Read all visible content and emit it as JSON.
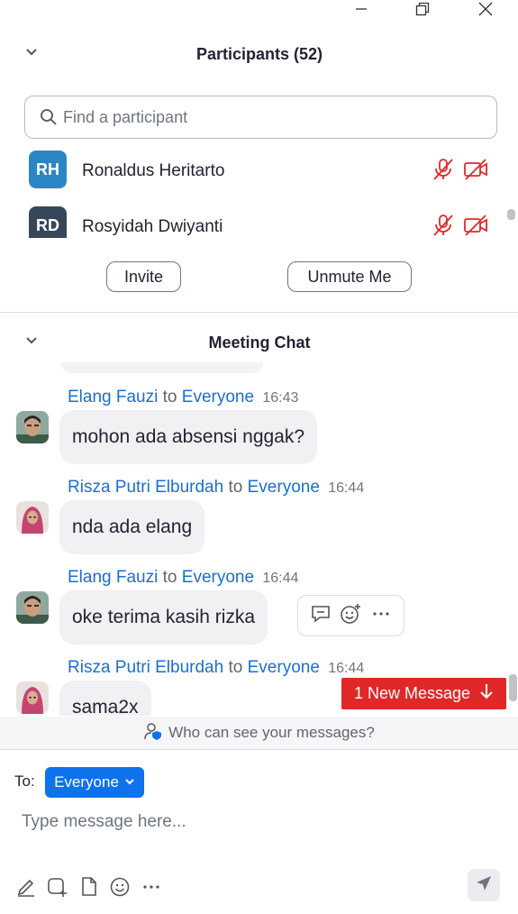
{
  "participants_panel": {
    "title": "Participants (52)",
    "search_placeholder": "Find a participant",
    "participants": [
      {
        "initials": "RH",
        "name": "Ronaldus Heritarto",
        "avatar_color": "#2d86c4",
        "mic_muted": true,
        "video_off": true
      },
      {
        "initials": "RD",
        "name": "Rosyidah Dwiyanti",
        "avatar_color": "#37475b",
        "mic_muted": true,
        "video_off": true
      }
    ],
    "invite_label": "Invite",
    "unmute_label": "Unmute Me"
  },
  "chat_panel": {
    "title": "Meeting Chat",
    "messages": [
      {
        "sender": "Elang Fauzi",
        "to_word": "to",
        "recipient": "Everyone",
        "time": "16:43",
        "text": "mohon ada absensi nggak?",
        "avatar": "male-photo"
      },
      {
        "sender": "Risza Putri Elburdah",
        "to_word": "to",
        "recipient": "Everyone",
        "time": "16:44",
        "text": "nda ada elang",
        "avatar": "female-hijab-photo"
      },
      {
        "sender": "Elang Fauzi",
        "to_word": "to",
        "recipient": "Everyone",
        "time": "16:44",
        "text": "oke terima kasih rizka",
        "avatar": "male-photo"
      },
      {
        "sender": "Risza Putri Elburdah",
        "to_word": "to",
        "recipient": "Everyone",
        "time": "16:44",
        "text": "sama2x",
        "avatar": "female-hijab-photo"
      }
    ],
    "new_message_label": "1 New Message",
    "visibility_text": "Who can see your messages?",
    "to_label": "To:",
    "recipient_selected": "Everyone",
    "input_placeholder": "Type message here..."
  },
  "colors": {
    "accent_blue": "#0e72ed",
    "link_blue": "#1a6fd1",
    "alert_red": "#e02828",
    "muted_red": "#e02828"
  },
  "icons": [
    "minimize-icon",
    "restore-icon",
    "close-icon",
    "chevron-down-icon",
    "search-icon",
    "mic-muted-icon",
    "video-off-icon",
    "reply-icon",
    "emoji-add-icon",
    "more-icon",
    "arrow-down-icon",
    "shield-user-icon",
    "format-icon",
    "screenshot-icon",
    "file-icon",
    "emoji-icon",
    "send-icon"
  ]
}
